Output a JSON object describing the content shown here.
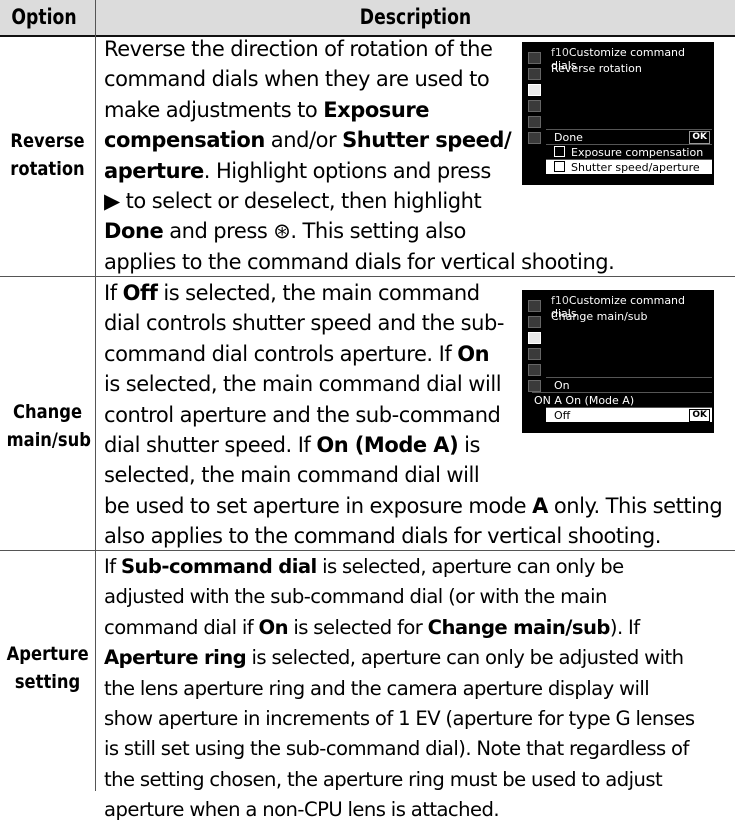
{
  "header": {
    "col_option": "Option",
    "col_description": "Description"
  },
  "rows": [
    {
      "option_line1": "Reverse",
      "option_line2": "rotation",
      "lines": [
        [
          "Reverse the direction of rotation of the"
        ],
        [
          "command dials when they are used to"
        ],
        [
          "make adjustments to ",
          "Exposure"
        ],
        [
          "compensation",
          " and/or ",
          "Shutter speed/"
        ],
        [
          "aperture",
          ".  Highlight options and press"
        ],
        [
          "▶ to select or deselect, then highlight"
        ],
        [
          "Done",
          " and press ⊛.  This setting also"
        ],
        [
          "applies to the command dials for vertical shooting."
        ]
      ],
      "screen": {
        "menu_code": "f10",
        "title": "Customize command dials",
        "subtitle": "Reverse rotation",
        "items": [
          "Done",
          "Exposure compensation",
          "Shutter speed/aperture"
        ],
        "ok_label": "OK"
      }
    },
    {
      "option_line1": "Change",
      "option_line2": "main/sub",
      "lines": [
        [
          "If ",
          "Off",
          " is selected, the main command"
        ],
        [
          "dial controls shutter speed and the sub-"
        ],
        [
          "command dial controls aperture.  If ",
          "On"
        ],
        [
          "is selected, the main command dial will"
        ],
        [
          "control aperture and the sub-command"
        ],
        [
          "dial shutter speed.  If ",
          "On (Mode A)",
          " is"
        ],
        [
          "selected, the main command dial will"
        ],
        [
          "be used to set aperture in exposure mode ",
          "A",
          " only.  This setting"
        ],
        [
          "also applies to the command dials for vertical shooting."
        ]
      ],
      "screen": {
        "menu_code": "f10",
        "title": "Customize command dials",
        "subtitle": "Change main/sub",
        "items": [
          "On",
          "On (Mode A)",
          "Off"
        ],
        "current_prefix": "ON A",
        "ok_label": "OK"
      }
    },
    {
      "option_line1": "Aperture",
      "option_line2": "setting",
      "lines": [
        [
          "If ",
          "Sub-command dial",
          " is selected, aperture can only be"
        ],
        [
          "adjusted with the sub-command dial (or with the main"
        ],
        [
          "command dial if ",
          "On",
          " is selected for ",
          "Change main/sub",
          ").  If"
        ],
        [
          "Aperture ring",
          " is selected, aperture can only be adjusted with"
        ],
        [
          "the lens aperture ring and the camera aperture display will"
        ],
        [
          "show aperture in increments of 1 EV (aperture for type G lenses"
        ],
        [
          "is still set using the sub-command dial).  Note that regardless of"
        ],
        [
          "the setting chosen, the aperture ring must be used to adjust"
        ],
        [
          "aperture when a non-CPU lens is attached."
        ]
      ]
    }
  ]
}
